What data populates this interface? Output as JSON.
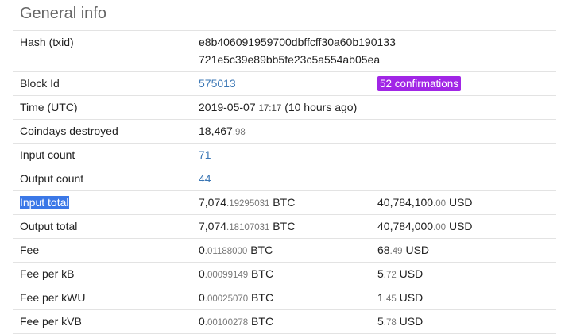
{
  "title": "General info",
  "hash": {
    "label": "Hash (txid)",
    "line1": "e8b406091959700dbffcff30a60b190133",
    "line2": "721e5c39e89bb5fe23c5a554ab05ea"
  },
  "block": {
    "label": "Block Id",
    "value": "575013",
    "confirmations": "52 confirmations",
    "badge_color": "#a126e6"
  },
  "time": {
    "label": "Time (UTC)",
    "date": "2019-05-07",
    "clock": "17:17",
    "ago": "(10 hours ago)"
  },
  "coindays": {
    "label": "Coindays destroyed",
    "int": "18,467",
    "frac": ".98"
  },
  "input_count": {
    "label": "Input count",
    "value": "71"
  },
  "output_count": {
    "label": "Output count",
    "value": "44"
  },
  "input_total": {
    "label": "Input total",
    "selected": true,
    "btc_int": "7,074",
    "btc_frac": ".19295031",
    "btc_unit": " BTC",
    "usd_int": "40,784,100",
    "usd_frac": ".00",
    "usd_unit": " USD"
  },
  "output_total": {
    "label": "Output total",
    "btc_int": "7,074",
    "btc_frac": ".18107031",
    "btc_unit": " BTC",
    "usd_int": "40,784,000",
    "usd_frac": ".00",
    "usd_unit": " USD"
  },
  "fee": {
    "label": "Fee",
    "btc_int": "0",
    "btc_frac": ".01188000",
    "btc_unit": " BTC",
    "usd_int": "68",
    "usd_frac": ".49",
    "usd_unit": " USD"
  },
  "fee_kb": {
    "label": "Fee per kB",
    "btc_int": "0",
    "btc_frac": ".00099149",
    "btc_unit": " BTC",
    "usd_int": "5",
    "usd_frac": ".72",
    "usd_unit": " USD"
  },
  "fee_kwu": {
    "label": "Fee per kWU",
    "btc_int": "0",
    "btc_frac": ".00025070",
    "btc_unit": " BTC",
    "usd_int": "1",
    "usd_frac": ".45",
    "usd_unit": " USD"
  },
  "fee_kvb": {
    "label": "Fee per kVB",
    "btc_int": "0",
    "btc_frac": ".00100278",
    "btc_unit": " BTC",
    "usd_int": "5",
    "usd_frac": ".78",
    "usd_unit": " USD"
  }
}
